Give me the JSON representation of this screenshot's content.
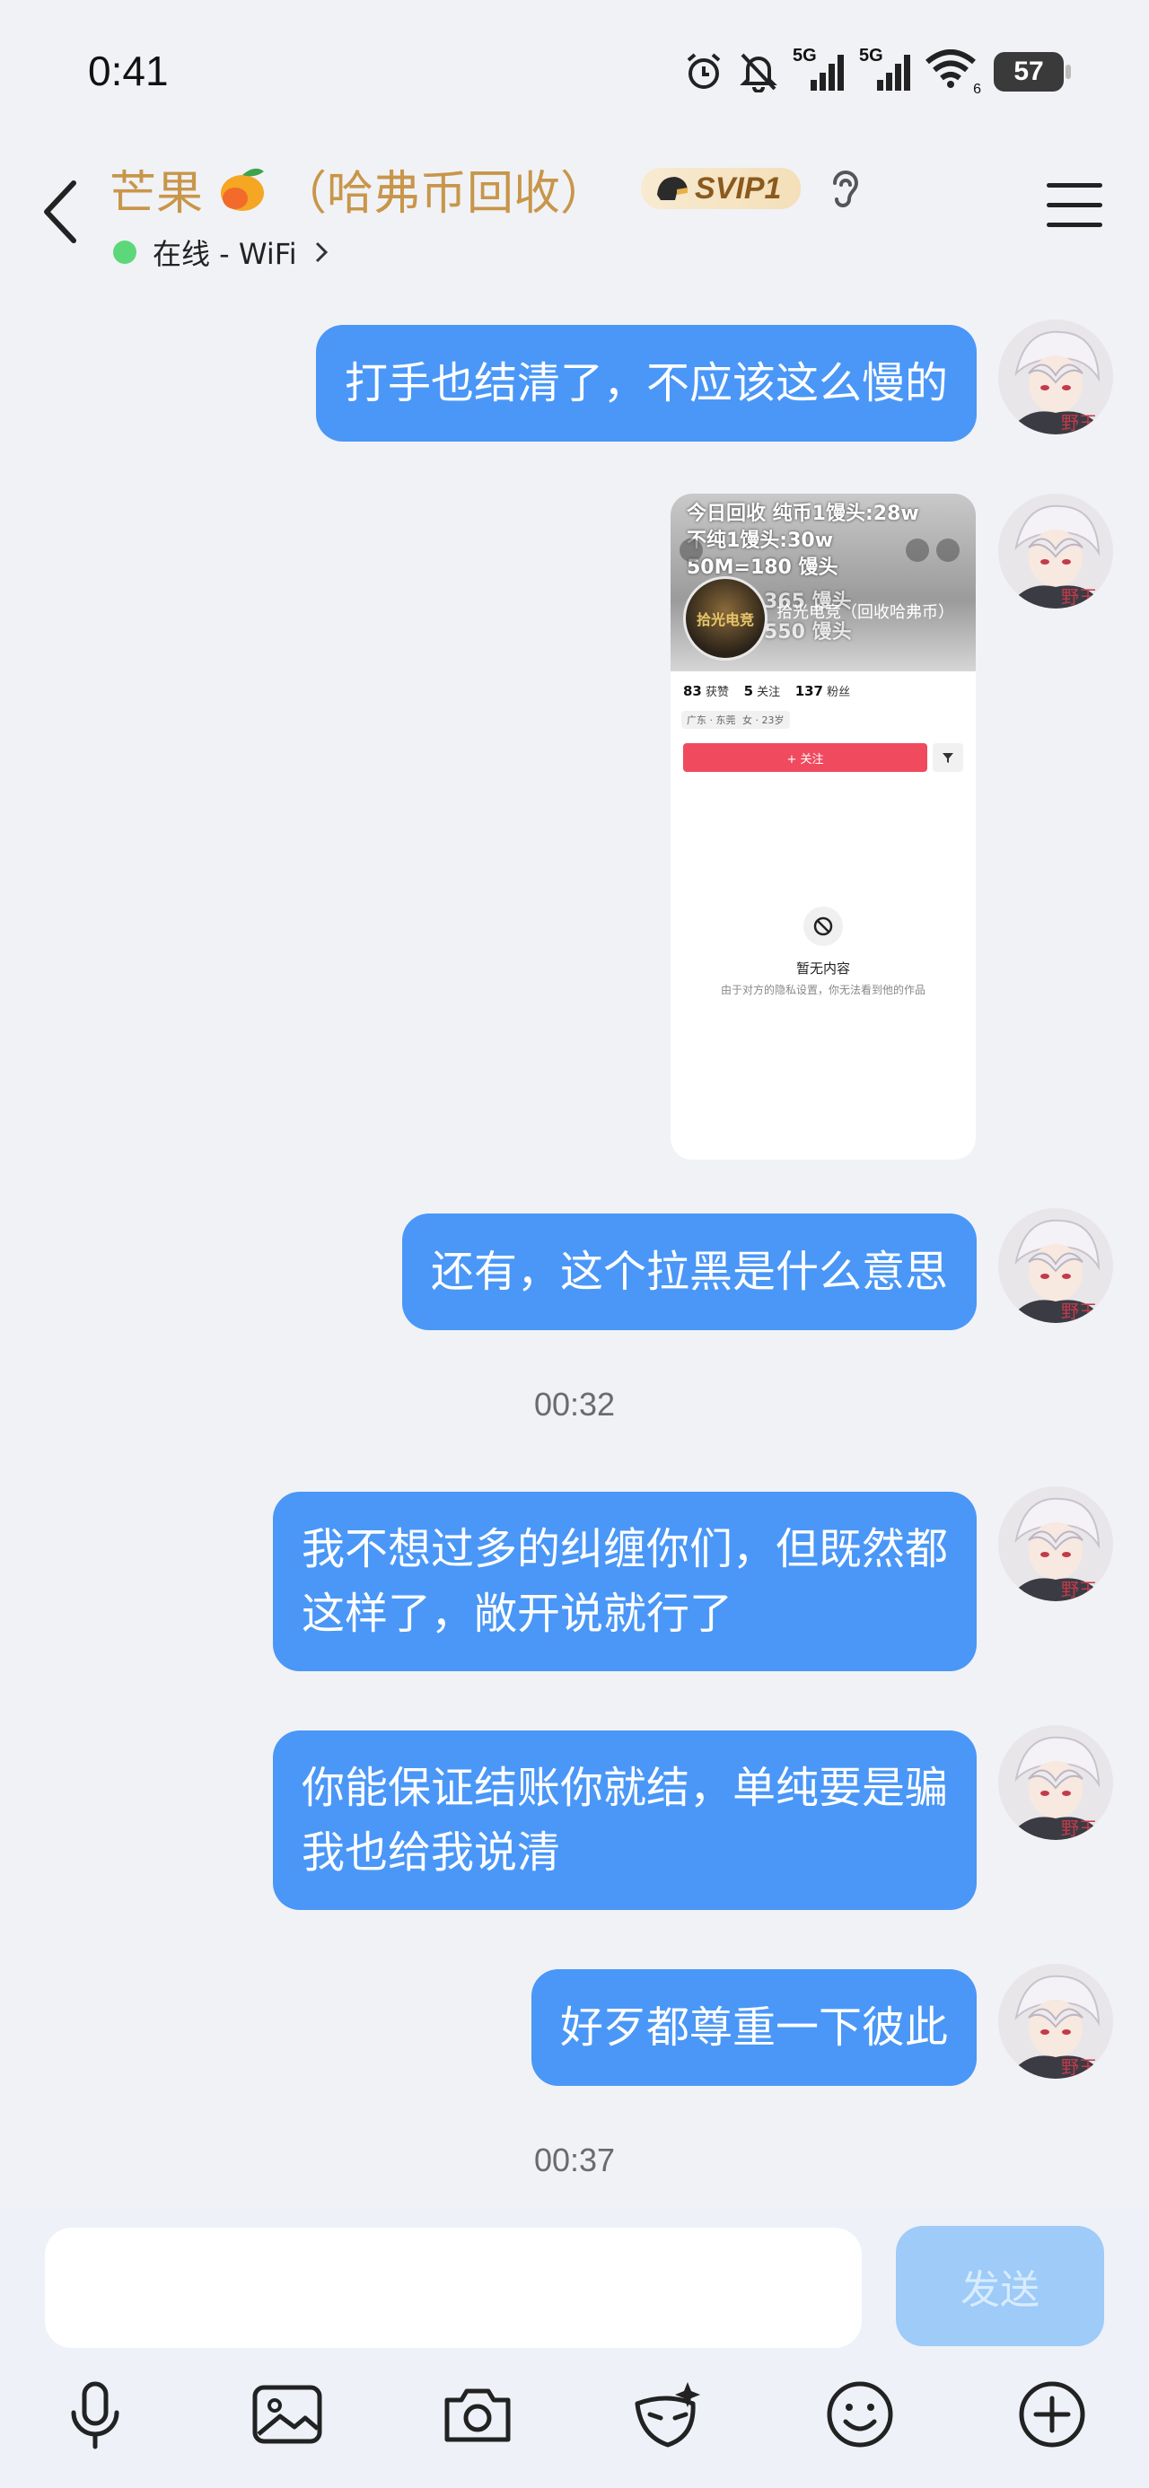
{
  "status_bar": {
    "time": "0:41",
    "network_1": "5G",
    "network_2": "5G",
    "wifi_sub": "6",
    "battery": "57"
  },
  "header": {
    "title": "芒果",
    "title_suffix": "（哈弗币回收）",
    "vip_badge": "SVIP1",
    "status": "在线 - WiFi",
    "icons": [
      "back-arrow-icon",
      "mango-emoji-icon",
      "helmet-icon",
      "ear-icon",
      "menu-icon"
    ]
  },
  "messages": [
    {
      "type": "text",
      "text": "打手也结清了，不应该这么慢的"
    },
    {
      "type": "image"
    },
    {
      "type": "text",
      "text": "还有，这个拉黑是什么意思"
    },
    {
      "type": "time",
      "text": "00:32"
    },
    {
      "type": "text",
      "line1": "我不想过多的纠缠你们，但既然都",
      "line2": "这样了，敞开说就行了"
    },
    {
      "type": "text",
      "line1": "你能保证结账你就结，单纯要是骗",
      "line2": "我也给我说清"
    },
    {
      "type": "text",
      "text": "好歹都尊重一下彼此"
    },
    {
      "type": "time",
      "text": "00:37"
    }
  ],
  "image_message": {
    "line1": "今日回收   纯币1馒头:28w",
    "line2": "不纯1馒头:30w",
    "line3": "50M=180 馒头",
    "line4": "365 馒头",
    "line5": "550 馒头",
    "logo": "拾光电竞",
    "account_name": "拾光电竞（回收哈弗币）",
    "likes_value": "83",
    "likes_label": "获赞",
    "following_value": "5",
    "following_label": "关注",
    "followers_value": "137",
    "followers_label": "粉丝",
    "tag_location": "广东 · 东莞",
    "tag_gender_age": "女 · 23岁",
    "follow_button": "+ 关注",
    "empty_title": "暂无内容",
    "empty_subtitle": "由于对方的隐私设置，你无法看到他的作品"
  },
  "avatar": {
    "badge": "野王"
  },
  "input_bar": {
    "send_label": "发送",
    "tools": [
      "microphone-icon",
      "image-icon",
      "camera-icon",
      "sticker-mask-icon",
      "emoji-icon",
      "plus-icon"
    ]
  },
  "colors": {
    "bubble": "#4A97F7",
    "title": "#C8964A",
    "online": "#5CD87B",
    "send_disabled": "#9ECBF7",
    "follow": "#F04A5F"
  }
}
